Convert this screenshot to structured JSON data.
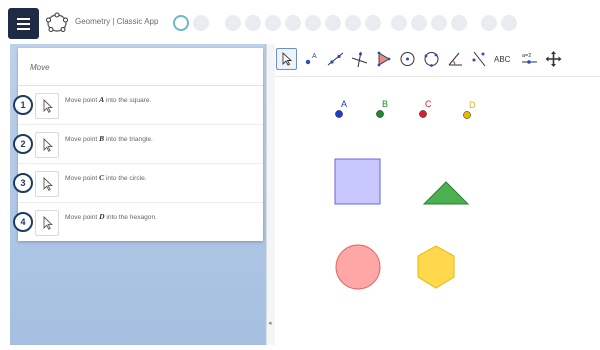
{
  "app": {
    "title": "Geometry | Classic App"
  },
  "progress": {
    "total": 16,
    "current_index": 0
  },
  "panel": {
    "title": "Move",
    "tasks": [
      {
        "number": "1",
        "before": "Move point ",
        "point": "A",
        "after": " into the square."
      },
      {
        "number": "2",
        "before": "Move point ",
        "point": "B",
        "after": " into the triangle."
      },
      {
        "number": "3",
        "before": "Move point ",
        "point": "C",
        "after": " into the circle."
      },
      {
        "number": "4",
        "before": "Move point ",
        "point": "D",
        "after": " into the hexagon."
      }
    ]
  },
  "toolbar": {
    "tools": [
      "move-tool",
      "point-tool",
      "line-tool",
      "perpendicular-line-tool",
      "polygon-tool",
      "circle-center-point-tool",
      "circle-three-points-tool",
      "angle-tool",
      "reflect-tool",
      "text-tool",
      "slider-tool",
      "move-graphics-view-tool"
    ],
    "text_label": "ABC",
    "slider_label": "a=2"
  },
  "graphics": {
    "points": [
      {
        "label": "A",
        "color": "#1a3fd0",
        "label_color": "#1a3fd0"
      },
      {
        "label": "B",
        "color": "#1e8a2c",
        "label_color": "#1e8a2c"
      },
      {
        "label": "C",
        "color": "#d8202a",
        "label_color": "#d8202a"
      },
      {
        "label": "D",
        "color": "#e6b800",
        "label_color": "#e6b800"
      }
    ],
    "shapes": {
      "square": {
        "fill": "#c8c8ff",
        "stroke": "#6666dd"
      },
      "triangle": {
        "fill": "#4caf50",
        "stroke": "#2e7d32"
      },
      "circle": {
        "fill": "#ffa7a7",
        "stroke": "#e06666"
      },
      "hexagon": {
        "fill": "#ffd84d",
        "stroke": "#e6b800"
      }
    }
  }
}
